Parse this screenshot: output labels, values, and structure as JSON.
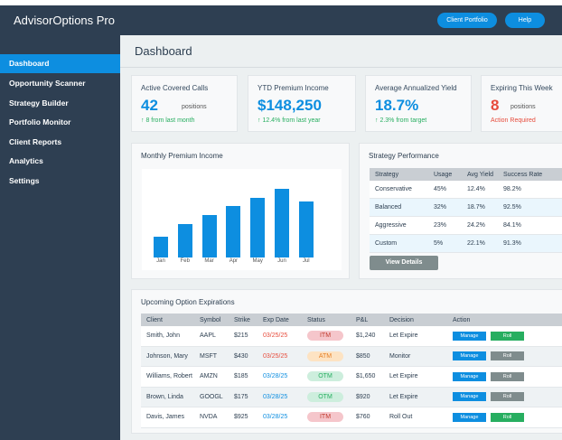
{
  "app": {
    "title": "AdvisorOptions Pro"
  },
  "header": {
    "client_portfolio_label": "Client Portfolio",
    "help_label": "Help"
  },
  "sidebar": {
    "items": [
      {
        "label": "Dashboard",
        "active": true
      },
      {
        "label": "Opportunity Scanner"
      },
      {
        "label": "Strategy Builder"
      },
      {
        "label": "Portfolio Monitor"
      },
      {
        "label": "Client Reports"
      },
      {
        "label": "Analytics"
      },
      {
        "label": "Settings"
      }
    ]
  },
  "page": {
    "title": "Dashboard"
  },
  "stats": [
    {
      "label": "Active Covered Calls",
      "value": "42",
      "unit": "positions",
      "trend": "↑ 8 from last month",
      "trend_color": "#27ae60",
      "value_color": "#0d8ee0"
    },
    {
      "label": "YTD Premium Income",
      "value": "$148,250",
      "unit": "",
      "trend": "↑ 12.4% from last year",
      "trend_color": "#27ae60",
      "value_color": "#0d8ee0"
    },
    {
      "label": "Average Annualized Yield",
      "value": "18.7%",
      "unit": "",
      "trend": "↑ 2.3% from target",
      "trend_color": "#27ae60",
      "value_color": "#0d8ee0"
    },
    {
      "label": "Expiring This Week",
      "value": "8",
      "unit": "positions",
      "trend": "Action Required",
      "trend_color": "#e74c3c",
      "value_color": "#e74c3c"
    }
  ],
  "monthly_chart": {
    "title": "Monthly Premium Income",
    "chart_data": {
      "type": "bar",
      "categories": [
        "Jan",
        "Feb",
        "Mar",
        "Apr",
        "May",
        "Jun",
        "Jul"
      ],
      "values": [
        27,
        43,
        54,
        65,
        76,
        87,
        71
      ],
      "ylim": [
        0,
        100
      ],
      "grid": false,
      "color": "#0d8ee0"
    }
  },
  "strategy": {
    "title": "Strategy Performance",
    "columns": [
      "Strategy",
      "Usage",
      "Avg Yield",
      "Success Rate"
    ],
    "rows": [
      [
        "Conservative",
        "45%",
        "12.4%",
        "98.2%"
      ],
      [
        "Balanced",
        "32%",
        "18.7%",
        "92.5%"
      ],
      [
        "Aggressive",
        "23%",
        "24.2%",
        "84.1%"
      ],
      [
        "Custom",
        "5%",
        "22.1%",
        "91.3%"
      ]
    ],
    "view_details_label": "View Details"
  },
  "expirations": {
    "title": "Upcoming Option Expirations",
    "columns": [
      "Client",
      "Symbol",
      "Strike",
      "Exp Date",
      "Status",
      "P&L",
      "Decision",
      "Action"
    ],
    "manage_label": "Manage",
    "roll_label": "Roll",
    "rows": [
      {
        "client": "Smith, John",
        "symbol": "AAPL",
        "strike": "$215",
        "exp": "03/25/25",
        "exp_color": "#e74c3c",
        "status": "ITM",
        "status_bg": "#f5c6cb",
        "status_color": "#c0392b",
        "pnl": "$1,240",
        "decision": "Let Expire",
        "roll_color": "#27ae60"
      },
      {
        "client": "Johnson, Mary",
        "symbol": "MSFT",
        "strike": "$430",
        "exp": "03/25/25",
        "exp_color": "#e74c3c",
        "status": "ATM",
        "status_bg": "#fde3c3",
        "status_color": "#e67e22",
        "pnl": "$850",
        "decision": "Monitor",
        "roll_color": "#7f8c8d"
      },
      {
        "client": "Williams, Robert",
        "symbol": "AMZN",
        "strike": "$185",
        "exp": "03/28/25",
        "exp_color": "#0d8ee0",
        "status": "OTM",
        "status_bg": "#cdeedd",
        "status_color": "#27ae60",
        "pnl": "$1,650",
        "decision": "Let Expire",
        "roll_color": "#7f8c8d"
      },
      {
        "client": "Brown, Linda",
        "symbol": "GOOGL",
        "strike": "$175",
        "exp": "03/28/25",
        "exp_color": "#0d8ee0",
        "status": "OTM",
        "status_bg": "#cdeedd",
        "status_color": "#27ae60",
        "pnl": "$920",
        "decision": "Let Expire",
        "roll_color": "#7f8c8d"
      },
      {
        "client": "Davis, James",
        "symbol": "NVDA",
        "strike": "$925",
        "exp": "03/28/25",
        "exp_color": "#0d8ee0",
        "status": "ITM",
        "status_bg": "#f5c6cb",
        "status_color": "#c0392b",
        "pnl": "$760",
        "decision": "Roll Out",
        "roll_color": "#27ae60"
      }
    ]
  },
  "colors": {
    "accent": "#0d8ee0",
    "sidebar": "#2e3f52",
    "positive": "#27ae60",
    "negative": "#e74c3c"
  }
}
